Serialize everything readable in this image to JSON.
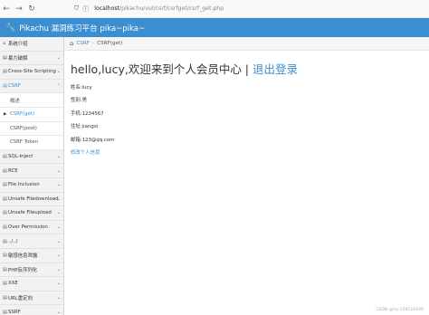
{
  "browser": {
    "url_host": "localhost",
    "url_path": "/pikachu/vul/csrf/csrfget/csrf_get.php"
  },
  "header": {
    "title": "Pikachu 漏洞练习平台 pika~pika~"
  },
  "sidebar": {
    "items": [
      {
        "label": "系统介绍"
      },
      {
        "label": "暴力破解"
      },
      {
        "label": "Cross-Site Scripting"
      },
      {
        "label": "CSRF"
      },
      {
        "label": "SQL-Inject"
      },
      {
        "label": "RCE"
      },
      {
        "label": "File Inclusion"
      },
      {
        "label": "Unsafe Filedownload"
      },
      {
        "label": "Unsafe Fileupload"
      },
      {
        "label": "Over Permission"
      },
      {
        "label": "../../"
      },
      {
        "label": "敏感信息泄露"
      },
      {
        "label": "PHP反序列化"
      },
      {
        "label": "XXE"
      },
      {
        "label": "URL重定向"
      },
      {
        "label": "SSRF"
      }
    ],
    "csrf_sub": [
      {
        "label": "概述"
      },
      {
        "label": "CSRF(get)"
      },
      {
        "label": "CSRF(post)"
      },
      {
        "label": "CSRF Token"
      }
    ]
  },
  "breadcrumb": {
    "parent": "CSRF",
    "current": "CSRF(get)"
  },
  "main": {
    "welcome": "hello,lucy,欢迎来到个人会员中心 | ",
    "logout": "退出登录",
    "fields": [
      "姓名:lucy",
      "性别:男",
      "手机:1234567",
      "住址:jiangxi",
      "邮箱:123@qq.com"
    ],
    "edit_link": "修改个人信息"
  },
  "watermark": "CSDN @hy-159116140"
}
